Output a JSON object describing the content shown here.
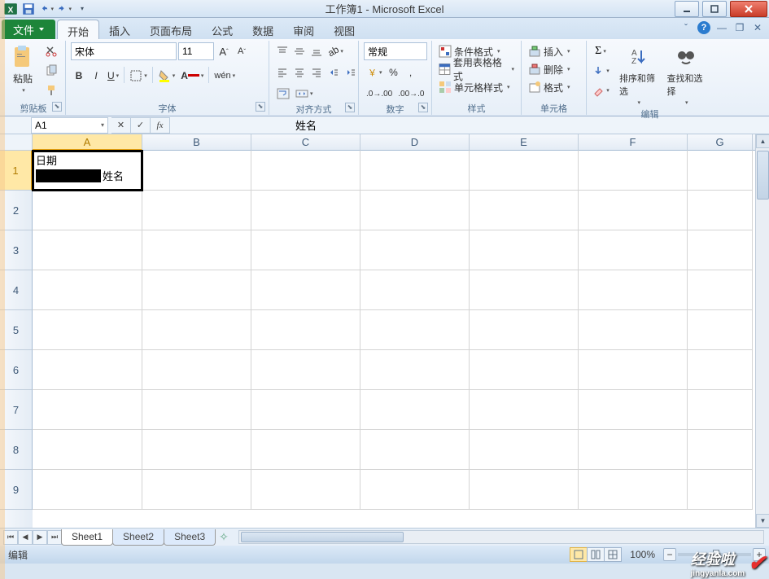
{
  "titlebar": {
    "title": "工作簿1 - Microsoft Excel"
  },
  "tabs": {
    "file": "文件",
    "items": [
      "开始",
      "插入",
      "页面布局",
      "公式",
      "数据",
      "审阅",
      "视图"
    ],
    "active": 0
  },
  "ribbon": {
    "clipboard": {
      "paste": "粘贴",
      "label": "剪贴板"
    },
    "font": {
      "name": "宋体",
      "size": "11",
      "label": "字体",
      "boldB": "B",
      "italicI": "I",
      "underlineU": "U"
    },
    "alignment": {
      "label": "对齐方式"
    },
    "number": {
      "label": "数字",
      "format": "常规"
    },
    "styles": {
      "label": "样式",
      "conditional": "条件格式",
      "table_fmt": "套用表格格式",
      "cell_styles": "单元格样式"
    },
    "cells": {
      "label": "单元格",
      "insert": "插入",
      "delete": "删除",
      "format": "格式"
    },
    "editing": {
      "label": "编辑",
      "sort": "排序和筛选",
      "find": "查找和选择"
    }
  },
  "formula_bar": {
    "name_box": "A1",
    "formula": "姓名"
  },
  "grid": {
    "columns": [
      "A",
      "B",
      "C",
      "D",
      "E",
      "F",
      "G"
    ],
    "rows": [
      "1",
      "2",
      "3",
      "4",
      "5",
      "6",
      "7",
      "8",
      "9"
    ],
    "cell_a1_line1": "日期",
    "cell_a1_line2": "姓名"
  },
  "sheets": {
    "tabs": [
      "Sheet1",
      "Sheet2",
      "Sheet3"
    ],
    "active": 0
  },
  "status": {
    "mode": "编辑",
    "zoom": "100%"
  },
  "watermark": {
    "brand": "经验啦",
    "url": "jingyanla.com"
  }
}
